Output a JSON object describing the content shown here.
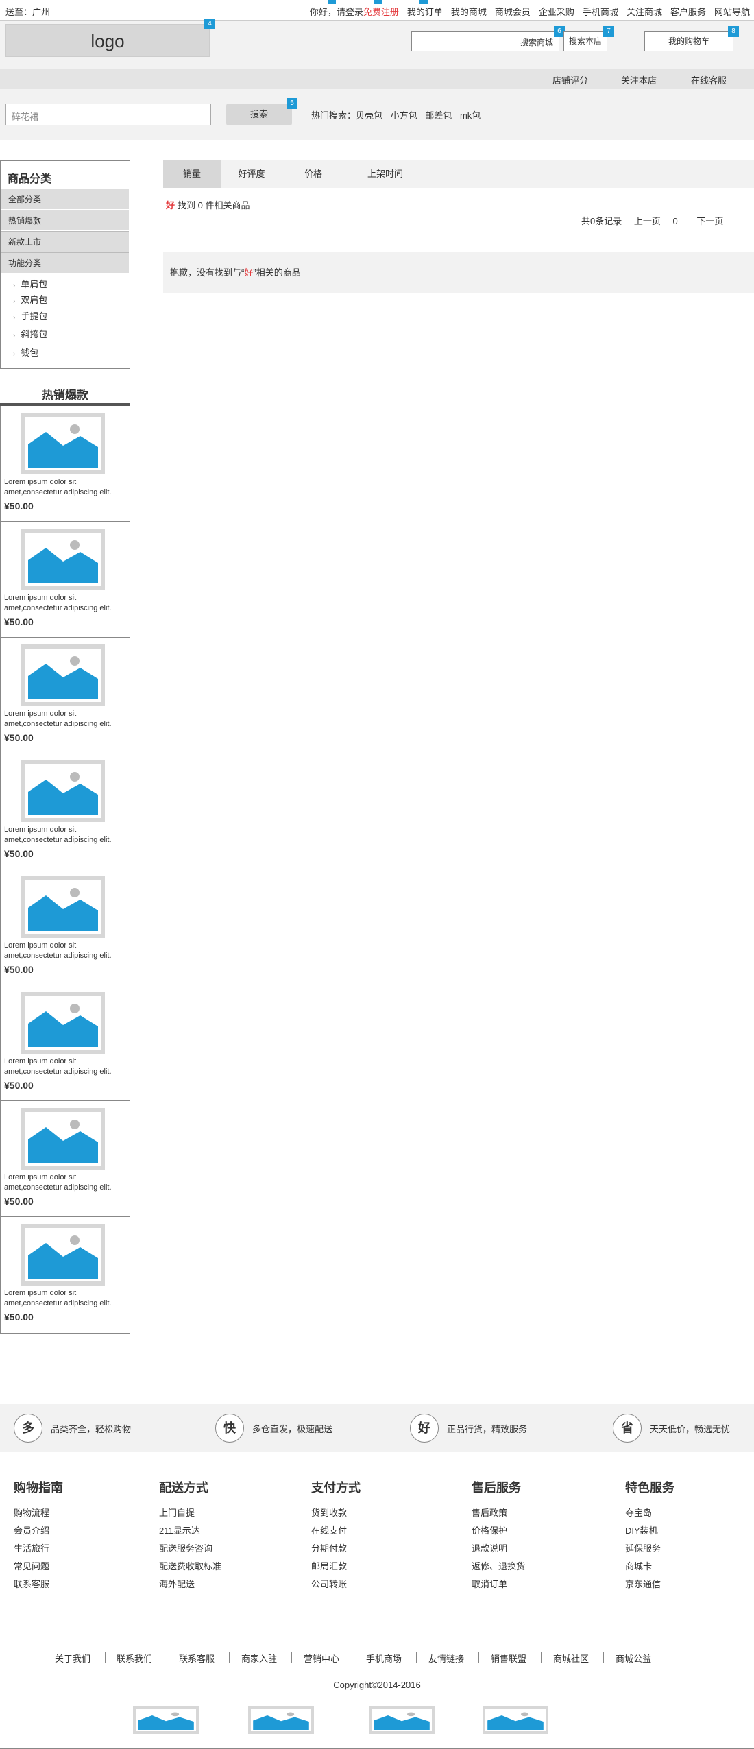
{
  "topbar": {
    "location": "送至：广州",
    "greeting": "你好，请登录",
    "register": "免费注册",
    "links": [
      "我的订单",
      "我的商城",
      "商城会员",
      "企业采购",
      "手机商城",
      "关注商城",
      "客户服务",
      "网站导航"
    ]
  },
  "header": {
    "logo": "logo",
    "search_mall": "搜索商城",
    "search_store": "搜索本店",
    "cart": "我的购物车",
    "badges": [
      "4",
      "6",
      "7",
      "8",
      "5"
    ]
  },
  "storenav": {
    "items": [
      "店铺评分",
      "关注本店",
      "在线客服"
    ]
  },
  "search": {
    "placeholder": "碎花裙",
    "button": "搜索",
    "hot_label": "热门搜索：",
    "hot_items": [
      "贝壳包",
      "小方包",
      "邮差包",
      "mk包"
    ]
  },
  "category": {
    "title": "商品分类",
    "rows": [
      "全部分类",
      "热销爆款",
      "新款上市",
      "功能分类"
    ],
    "subs": [
      "单肩包",
      "双肩包",
      "手提包",
      "斜挎包",
      "钱包"
    ]
  },
  "hot": {
    "title": "热销爆款",
    "products": [
      {
        "desc": "Lorem ipsum dolor sit amet,consectetur adipiscing elit.",
        "price": "¥50.00"
      },
      {
        "desc": "Lorem ipsum dolor sit amet,consectetur adipiscing elit.",
        "price": "¥50.00"
      },
      {
        "desc": "Lorem ipsum dolor sit amet,consectetur adipiscing elit.",
        "price": "¥50.00"
      },
      {
        "desc": "Lorem ipsum dolor sit amet,consectetur adipiscing elit.",
        "price": "¥50.00"
      },
      {
        "desc": "Lorem ipsum dolor sit amet,consectetur adipiscing elit.",
        "price": "¥50.00"
      },
      {
        "desc": "Lorem ipsum dolor sit amet,consectetur adipiscing elit.",
        "price": "¥50.00"
      },
      {
        "desc": "Lorem ipsum dolor sit amet,consectetur adipiscing elit.",
        "price": "¥50.00"
      },
      {
        "desc": "Lorem ipsum dolor sit amet,consectetur adipiscing elit.",
        "price": "¥50.00"
      }
    ]
  },
  "main": {
    "tabs": [
      "销量",
      "好评度",
      "价格",
      "上架时间"
    ],
    "keyword": "好",
    "found_text": "找到 0 件相关商品",
    "pager": {
      "total": "共0条记录",
      "prev": "上一页",
      "page": "0",
      "next": "下一页"
    },
    "noresult_pre": "抱歉，没有找到与“",
    "noresult_kw": "好",
    "noresult_post": "”相关的商品"
  },
  "services": [
    {
      "char": "多",
      "text": "品类齐全，轻松购物"
    },
    {
      "char": "快",
      "text": "多仓直发，极速配送"
    },
    {
      "char": "好",
      "text": "正品行货，精致服务"
    },
    {
      "char": "省",
      "text": "天天低价，畅选无忧"
    }
  ],
  "footer_cols": [
    {
      "title": "购物指南",
      "items": [
        "购物流程",
        "会员介绍",
        "生活旅行",
        "常见问题",
        "联系客服"
      ]
    },
    {
      "title": "配送方式",
      "items": [
        "上门自提",
        "211显示达",
        "配送服务咨询",
        "配送费收取标准",
        "海外配送"
      ]
    },
    {
      "title": "支付方式",
      "items": [
        "货到收款",
        "在线支付",
        "分期付款",
        "邮局汇款",
        "公司转账"
      ]
    },
    {
      "title": "售后服务",
      "items": [
        "售后政策",
        "价格保护",
        "退款说明",
        "返修、退换货",
        "取消订单"
      ]
    },
    {
      "title": "特色服务",
      "items": [
        "夺宝岛",
        "DIY装机",
        "延保服务",
        "商城卡",
        "京东通信"
      ]
    }
  ],
  "footer_links": [
    "关于我们",
    "联系我们",
    "联系客服",
    "商家入驻",
    "营销中心",
    "手机商场",
    "友情链接",
    "销售联盟",
    "商城社区",
    "商城公益"
  ],
  "copyright": "Copyright©2014-2016",
  "colors": {
    "accent": "#1e9ad6",
    "red": "#e4393c",
    "panel": "#f2f2f2",
    "gray": "#d7d7d7"
  }
}
